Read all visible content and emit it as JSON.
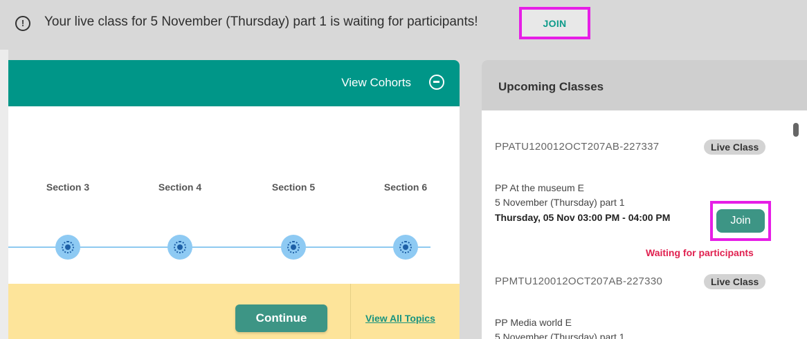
{
  "banner": {
    "icon": "exclamation-circle-icon",
    "message": "Your live class for 5 November (Thursday) part 1 is waiting for participants!",
    "join_label": "JOIN"
  },
  "cohort_panel": {
    "view_cohorts_label": "View Cohorts",
    "toggle_icon": "minus-circle-icon",
    "sections": [
      "Section 3",
      "Section 4",
      "Section 5",
      "Section 6"
    ],
    "continue_label": "Continue",
    "view_all_topics_label": "View All Topics"
  },
  "upcoming": {
    "title": "Upcoming Classes",
    "classes": [
      {
        "code": "PPATU120012OCT207AB-227337",
        "badge": "Live Class",
        "name": "PP At the museum E",
        "part": "5 November (Thursday) part 1",
        "time": "Thursday, 05 Nov 03:00 PM - 04:00 PM",
        "join_label": "Join",
        "status": "Waiting for participants"
      },
      {
        "code": "PPMTU120012OCT207AB-227330",
        "badge": "Live Class",
        "name": "PP Media world E",
        "part": "5 November (Thursday) part 1"
      }
    ]
  },
  "colors": {
    "teal": "#009688",
    "button_teal": "#3d9585",
    "highlight_magenta": "#e61ee6",
    "status_red": "#e0204f",
    "footer_yellow": "#fde49a"
  }
}
